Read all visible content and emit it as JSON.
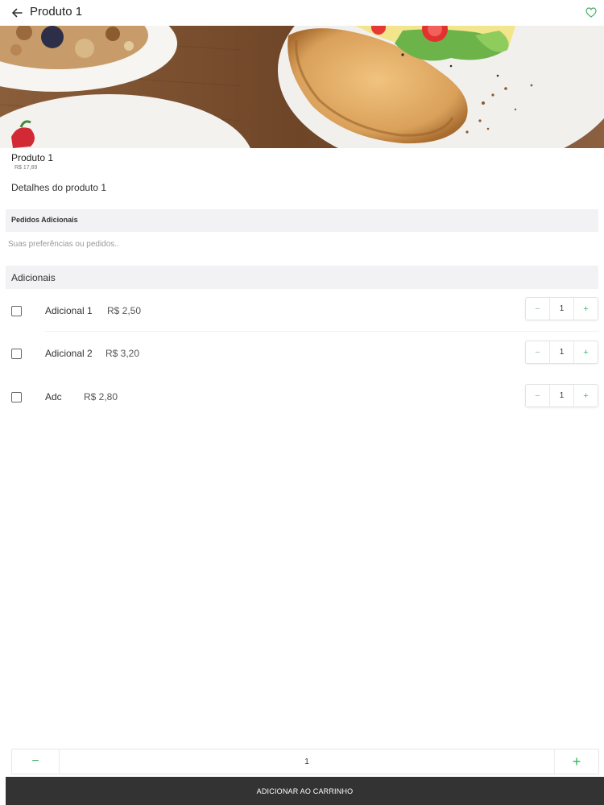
{
  "header": {
    "back_icon": "arrow-left-icon",
    "title": "Produto 1",
    "favorite_icon": "heart-outline-icon"
  },
  "product": {
    "image_icon": "food-photo",
    "name": "Produto 1",
    "price": "R$ 17,89",
    "details": "Detalhes do produto 1"
  },
  "pedidos": {
    "heading": "Pedidos Adicionais",
    "notes_value": "",
    "notes_placeholder": "Suas preferências ou pedidos.."
  },
  "adicionais": {
    "heading": "Adicionais",
    "items": [
      {
        "name": "Adicional 1",
        "price": "R$ 2,50",
        "checked": false,
        "qty": "1"
      },
      {
        "name": "Adicional 2",
        "price": "R$ 3,20",
        "checked": false,
        "qty": "1"
      },
      {
        "name": "Adc",
        "price": "R$ 2,80",
        "checked": false,
        "qty": "1"
      }
    ],
    "minus_label": "−",
    "plus_label": "+"
  },
  "quantity": {
    "minus_label": "−",
    "value": "1",
    "plus_label": "+"
  },
  "cart_button": {
    "label": "ADICIONAR AO CARRINHO"
  },
  "colors": {
    "accent": "#2eb85c",
    "cart_bg": "#333333",
    "section_bg": "#f2f2f4"
  }
}
